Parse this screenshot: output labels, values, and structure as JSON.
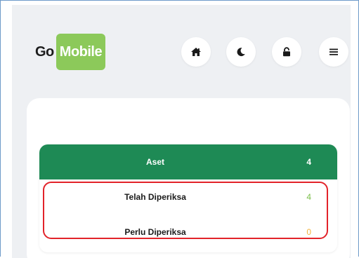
{
  "logo": {
    "part1": "Go",
    "part2": "Mobile"
  },
  "nav": {
    "home_icon": "home-icon",
    "theme_icon": "moon-icon",
    "lock_icon": "lock-icon",
    "menu_icon": "menu-icon"
  },
  "summary": {
    "header": {
      "label": "Aset",
      "count": "4"
    },
    "rows": [
      {
        "label": "Telah Diperiksa",
        "count": "4",
        "color": "#7bbf4a"
      },
      {
        "label": "Perlu Diperiksa",
        "count": "0",
        "color": "#f2b23a"
      }
    ]
  },
  "colors": {
    "brand_green": "#8cc95a",
    "header_green": "#1e8a55",
    "highlight_red": "#e2232a"
  }
}
